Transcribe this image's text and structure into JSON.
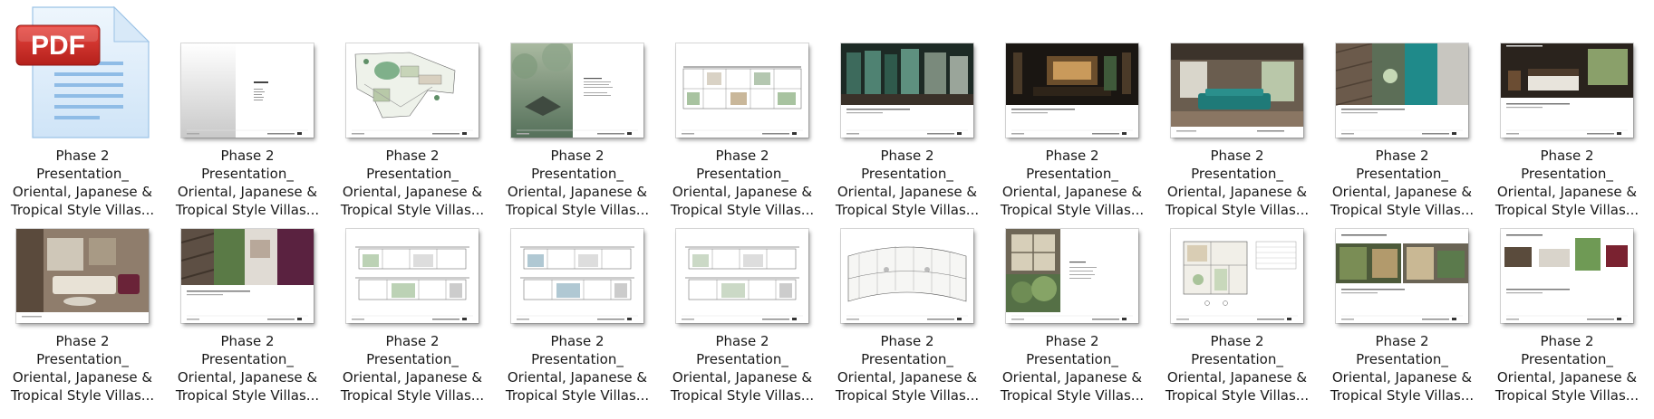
{
  "file_icon": {
    "badge_text": "PDF"
  },
  "items": [
    {
      "l1": "Phase 2",
      "l2": "Presentation_",
      "l3": "Oriental, Japanese &",
      "l4": "Tropical Style Villas...",
      "thumb": "pdf-icon"
    },
    {
      "l1": "Phase 2",
      "l2": "Presentation_",
      "l3": "Oriental, Japanese &",
      "l4": "Tropical Style Villas...",
      "thumb": "cover-mist"
    },
    {
      "l1": "Phase 2",
      "l2": "Presentation_",
      "l3": "Oriental, Japanese &",
      "l4": "Tropical Style Villas...",
      "thumb": "site-plan"
    },
    {
      "l1": "Phase 2",
      "l2": "Presentation_",
      "l3": "Oriental, Japanese &",
      "l4": "Tropical Style Villas...",
      "thumb": "forest-text"
    },
    {
      "l1": "Phase 2",
      "l2": "Presentation_",
      "l3": "Oriental, Japanese &",
      "l4": "Tropical Style Villas...",
      "thumb": "section-drawing"
    },
    {
      "l1": "Phase 2",
      "l2": "Presentation_",
      "l3": "Oriental, Japanese &",
      "l4": "Tropical Style Villas...",
      "thumb": "green-interior"
    },
    {
      "l1": "Phase 2",
      "l2": "Presentation_",
      "l3": "Oriental, Japanese &",
      "l4": "Tropical Style Villas...",
      "thumb": "dark-lobby"
    },
    {
      "l1": "Phase 2",
      "l2": "Presentation_",
      "l3": "Oriental, Japanese &",
      "l4": "Tropical Style Villas...",
      "thumb": "living-room-teal"
    },
    {
      "l1": "Phase 2",
      "l2": "Presentation_",
      "l3": "Oriental, Japanese &",
      "l4": "Tropical Style Villas...",
      "thumb": "material-board"
    },
    {
      "l1": "Phase 2",
      "l2": "Presentation_",
      "l3": "Oriental, Japanese &",
      "l4": "Tropical Style Villas...",
      "thumb": "bedroom-dark"
    },
    {
      "l1": "Phase 2",
      "l2": "Presentation_",
      "l3": "Oriental, Japanese &",
      "l4": "Tropical Style Villas...",
      "thumb": "living-room-warm"
    },
    {
      "l1": "Phase 2",
      "l2": "Presentation_",
      "l3": "Oriental, Japanese &",
      "l4": "Tropical Style Villas...",
      "thumb": "moodboard-purple"
    },
    {
      "l1": "Phase 2",
      "l2": "Presentation_",
      "l3": "Oriental, Japanese &",
      "l4": "Tropical Style Villas...",
      "thumb": "elevations-a"
    },
    {
      "l1": "Phase 2",
      "l2": "Presentation_",
      "l3": "Oriental, Japanese &",
      "l4": "Tropical Style Villas...",
      "thumb": "elevations-b"
    },
    {
      "l1": "Phase 2",
      "l2": "Presentation_",
      "l3": "Oriental, Japanese &",
      "l4": "Tropical Style Villas...",
      "thumb": "elevations-c"
    },
    {
      "l1": "Phase 2",
      "l2": "Presentation_",
      "l3": "Oriental, Japanese &",
      "l4": "Tropical Style Villas...",
      "thumb": "curved-plan"
    },
    {
      "l1": "Phase 2",
      "l2": "Presentation_",
      "l3": "Oriental, Japanese &",
      "l4": "Tropical Style Villas...",
      "thumb": "japanese-garden"
    },
    {
      "l1": "Phase 2",
      "l2": "Presentation_",
      "l3": "Oriental, Japanese &",
      "l4": "Tropical Style Villas...",
      "thumb": "floor-plan"
    },
    {
      "l1": "Phase 2",
      "l2": "Presentation_",
      "l3": "Oriental, Japanese &",
      "l4": "Tropical Style Villas...",
      "thumb": "tropical-photos"
    },
    {
      "l1": "Phase 2",
      "l2": "Presentation_",
      "l3": "Oriental, Japanese &",
      "l4": "Tropical Style Villas...",
      "thumb": "furniture-board"
    }
  ]
}
